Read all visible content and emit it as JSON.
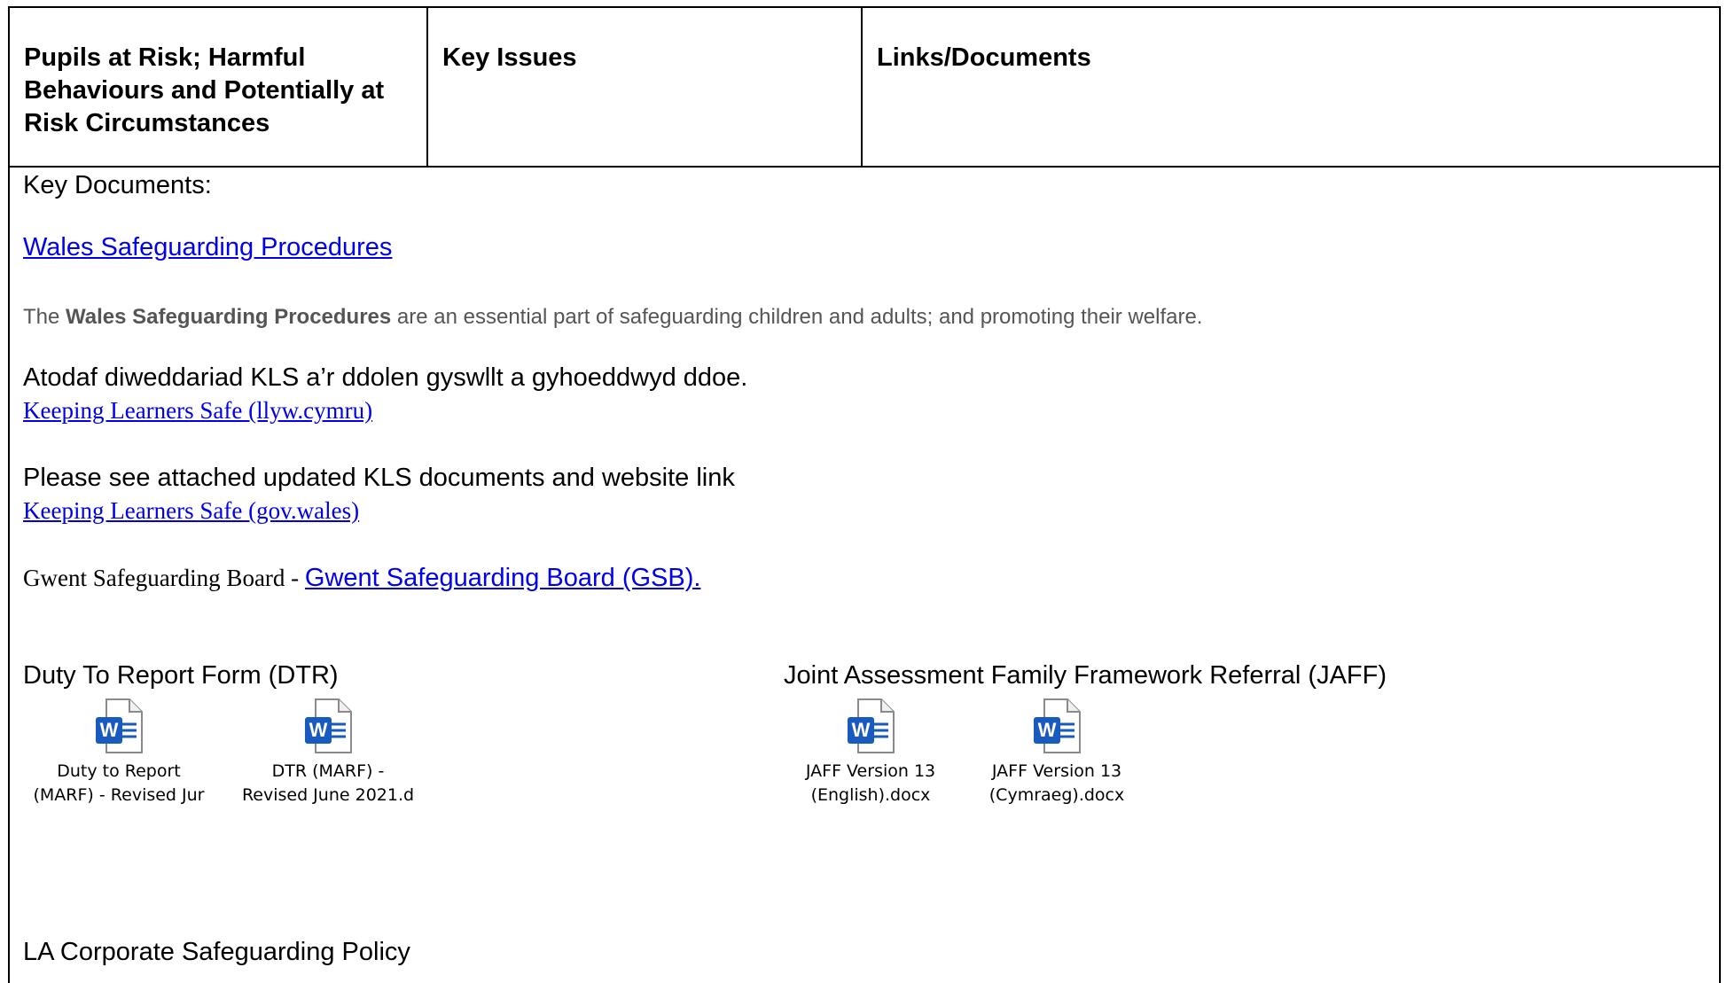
{
  "header": {
    "col1": "Pupils at Risk;  Harmful Behaviours and Potentially at Risk Circumstances",
    "col2": "Key Issues",
    "col3": "Links/Documents"
  },
  "content": {
    "key_documents_label": "Key Documents:",
    "wales_procedures_link": "Wales Safeguarding Procedures",
    "procedures_desc_prefix": "The ",
    "procedures_desc_bold": "Wales Safeguarding Procedures",
    "procedures_desc_suffix": " are an essential part of safeguarding children and adults; and promoting their welfare.",
    "welsh_update_text": "Atodaf diweddariad KLS a’r ddolen gyswllt a gyhoeddwyd ddoe.",
    "kls_welsh_link": "Keeping Learners Safe (llyw.cymru)",
    "english_update_text": "Please see attached updated KLS documents and website link",
    "kls_english_link": "Keeping Learners Safe (gov.wales)",
    "gwent_prefix": "Gwent Safeguarding Board - ",
    "gwent_link": "Gwent Safeguarding Board (GSB).",
    "dtr_heading": "Duty To Report Form (DTR)",
    "jaff_heading": "Joint Assessment Family Framework Referral (JAFF)",
    "la_policy_heading": "LA Corporate Safeguarding Policy"
  },
  "attachments": [
    {
      "line1": "Duty to Report",
      "line2": "(MARF) - Revised Jur",
      "icon": "word-doc-icon"
    },
    {
      "line1": "DTR (MARF) -",
      "line2": "Revised June 2021.d",
      "icon": "word-doc-icon"
    },
    {
      "line1": "JAFF Version 13",
      "line2": "(English).docx",
      "icon": "word-doc-icon"
    },
    {
      "line1": "JAFF Version 13",
      "line2": "(Cymraeg).docx",
      "icon": "word-doc-icon"
    }
  ],
  "colors": {
    "link": "#0000ee",
    "word_blue": "#185abd",
    "grey_text": "#555555"
  }
}
